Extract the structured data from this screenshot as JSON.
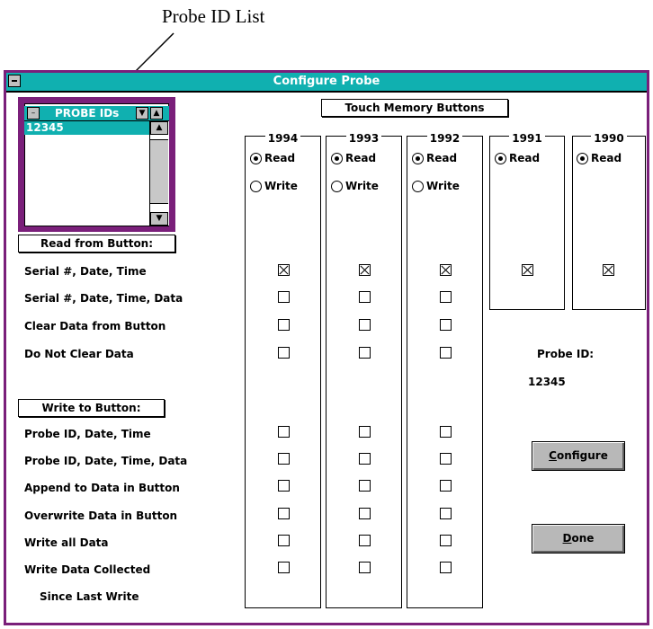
{
  "annotations": {
    "top_caption": "Probe ID List"
  },
  "window": {
    "title": "Configure Probe"
  },
  "probe_list": {
    "header": "PROBE IDs",
    "items": [
      "12345"
    ]
  },
  "touch_memory_label": "Touch Memory Buttons",
  "columns": [
    {
      "year": "1994",
      "read_label": "Read",
      "write_label": "Write"
    },
    {
      "year": "1993",
      "read_label": "Read",
      "write_label": "Write"
    },
    {
      "year": "1992",
      "read_label": "Read",
      "write_label": "Write"
    },
    {
      "year": "1991",
      "read_label": "Read"
    },
    {
      "year": "1990",
      "read_label": "Read"
    }
  ],
  "read_section": {
    "header": "Read from Button:",
    "options": [
      "Serial #, Date, Time",
      "Serial #, Date, Time, Data",
      "Clear Data from Button",
      "Do Not Clear Data"
    ]
  },
  "write_section": {
    "header": "Write to Button:",
    "options": [
      "Probe ID, Date, Time",
      "Probe ID, Date, Time, Data",
      "Append to Data in Button",
      "Overwrite Data in Button",
      "Write all Data",
      "Write Data Collected"
    ],
    "continuation": "Since Last Write"
  },
  "probe_id_display": {
    "label": "Probe ID:",
    "value": "12345"
  },
  "buttons": {
    "configure_first": "C",
    "configure_rest": "onfigure",
    "done_first": "D",
    "done_rest": "one"
  }
}
